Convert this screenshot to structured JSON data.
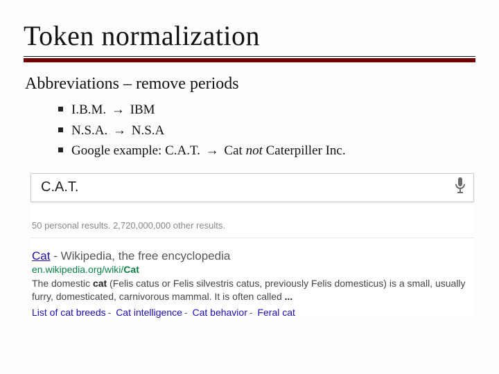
{
  "title": "Token normalization",
  "subhead": "Abbreviations – remove periods",
  "bullets": {
    "b1_src": "I.B.M.",
    "b1_dst": "IBM",
    "b2_src": "N.S.A.",
    "b2_dst": "N.S.A",
    "b3_prefix": "Google example: C.A.T.",
    "b3_mid": "Cat",
    "b3_ital": "not",
    "b3_end": "Caterpiller Inc."
  },
  "arrow": "→",
  "search": {
    "query": "C.A.T."
  },
  "stats": "50 personal results. 2,720,000,000 other results.",
  "result": {
    "title_link": "Cat",
    "title_rest": " - Wikipedia, the free encyclopedia",
    "url_pre": "en.wikipedia.org/wiki/",
    "url_bold": "Cat",
    "snippet_a": "The domestic ",
    "snippet_b1": "cat",
    "snippet_c": " (Felis catus or Felis silvestris catus, previously Felis domesticus) is a small, usually furry, domesticated, carnivorous mammal. It is often called ",
    "snippet_b2": "...",
    "links": {
      "l1": "List of cat breeds",
      "l2": "Cat intelligence",
      "l3": "Cat behavior",
      "l4": "Feral cat"
    }
  }
}
